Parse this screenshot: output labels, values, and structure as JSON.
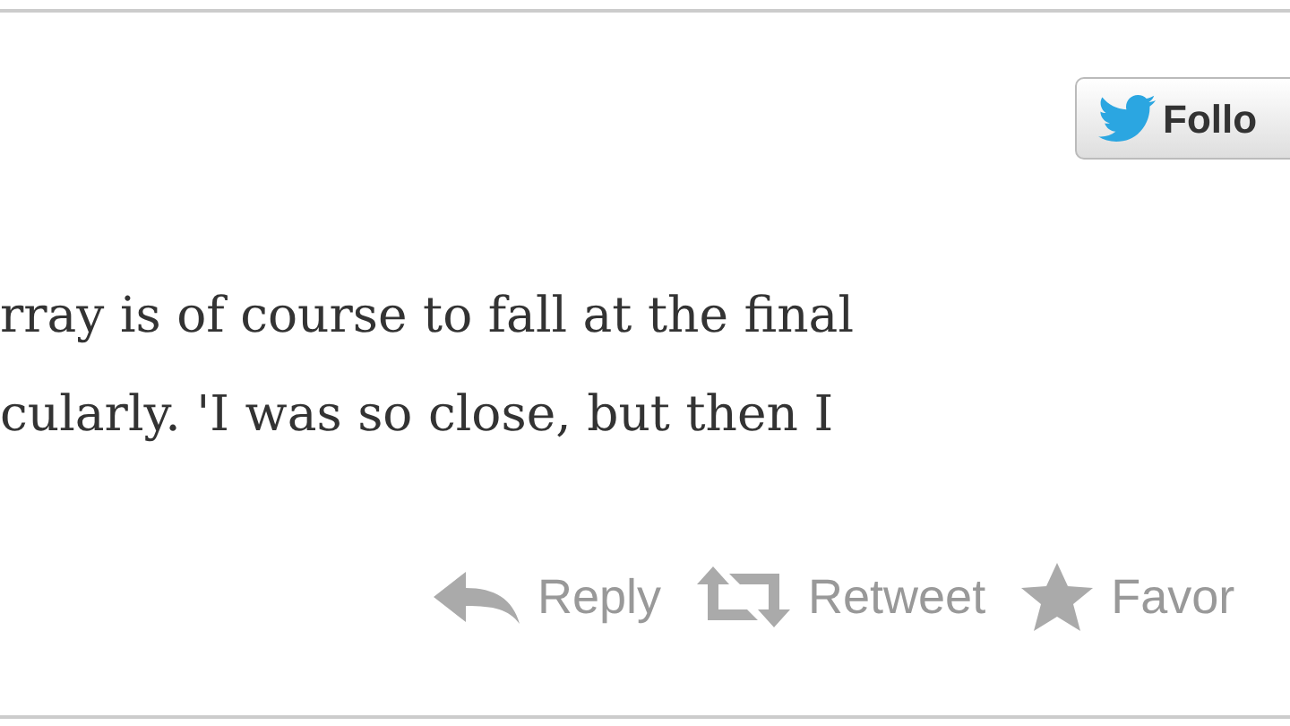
{
  "follow_button": {
    "label": "Follo"
  },
  "tweet": {
    "lines": [
      "rray is of course to fall at the final",
      "cularly. 'I was so close, but then I"
    ]
  },
  "actions": [
    {
      "kind": "reply",
      "label": "Reply"
    },
    {
      "kind": "retweet",
      "label": "Retweet"
    },
    {
      "kind": "favorite",
      "label": "Favor"
    }
  ]
}
